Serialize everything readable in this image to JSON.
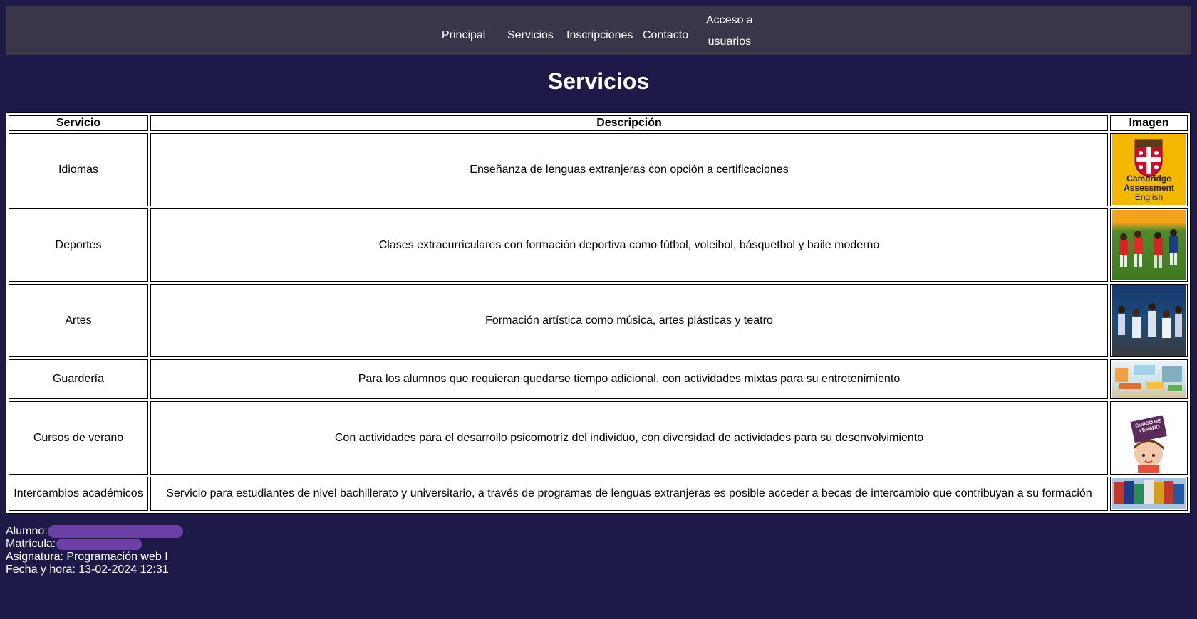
{
  "nav": {
    "principal": "Principal",
    "servicios": "Servicios",
    "inscripciones": "Inscripciones",
    "contacto": "Contacto",
    "acceso_line1": "Acceso a",
    "acceso_line2": "usuarios"
  },
  "page_title": "Servicios",
  "table": {
    "headers": [
      "Servicio",
      "Descripción",
      "Imagen"
    ],
    "rows": [
      {
        "servicio": "Idiomas",
        "descripcion": "Enseñanza de lenguas extranjeras con opción a certificaciones",
        "image": "cambridge-logo"
      },
      {
        "servicio": "Deportes",
        "descripcion": "Clases extracurriculares con formación deportiva como fútbol, voleibol, básquetbol y baile moderno",
        "image": "soccer-kids-photo"
      },
      {
        "servicio": "Artes",
        "descripcion": "Formación artística como música, artes plásticas y teatro",
        "image": "dance-class-photo"
      },
      {
        "servicio": "Guardería",
        "descripcion": "Para los alumnos que requieran quedarse tiempo adicional, con actividades mixtas para su entretenimiento",
        "image": "classroom-photo"
      },
      {
        "servicio": "Cursos de verano",
        "descripcion": "Con actividades para el desarrollo psicomotríz del individuo, con diversidad de actividades para su desenvolvimiento",
        "image": "summer-course-illustration"
      },
      {
        "servicio": "Intercambios académicos",
        "descripcion": "Servicio para estudiantes de nivel bachillerato y universitario, a través de programas de lenguas extranjeras es posible acceder a becas de intercambio que contribuyan a su formación",
        "image": "flags-photo"
      }
    ]
  },
  "cambridge_logo": {
    "line1": "Cambridge",
    "line2": "Assessment",
    "line3": "English"
  },
  "summer_sign": {
    "line1": "CURSO DE",
    "line2": "VERANO"
  },
  "footer": {
    "alumno_label": "Alumno:",
    "matricula_label": "Matrícula:",
    "asignatura": "Asignatura: Programación web I",
    "fecha": "Fecha y hora: 13-02-2024 12:31"
  },
  "colors": {
    "background": "#1e1a48",
    "navbar": "#3a3548",
    "redaction": "#6a3fa6"
  }
}
